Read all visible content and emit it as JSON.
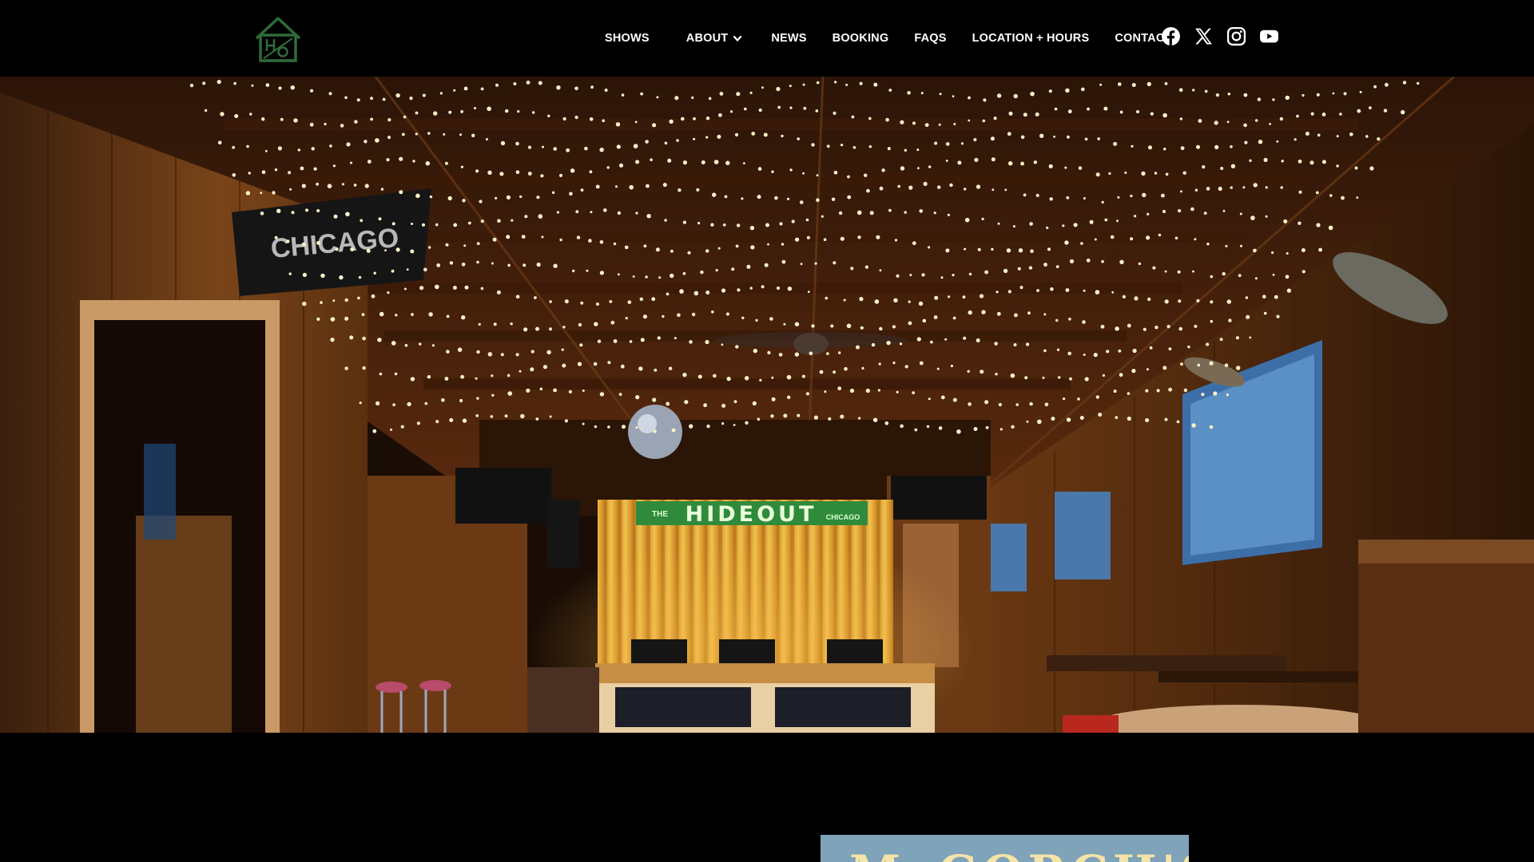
{
  "site": {
    "logo_icon": "hideout-house-logo-icon",
    "brand_color": "#2f6b3a"
  },
  "nav": {
    "items": [
      {
        "label": "SHOWS"
      },
      {
        "label": "ABOUT",
        "has_dropdown": true
      },
      {
        "label": "NEWS"
      },
      {
        "label": "BOOKING"
      },
      {
        "label": "FAQS"
      },
      {
        "label": "LOCATION + HOURS"
      },
      {
        "label": "CONTACT"
      }
    ]
  },
  "social": [
    {
      "icon": "facebook-icon"
    },
    {
      "icon": "x-twitter-icon"
    },
    {
      "icon": "instagram-icon"
    },
    {
      "icon": "youtube-icon"
    }
  ],
  "hero": {
    "wall_sign": "CHICAGO",
    "stage_banner_main": "HIDEOUT",
    "stage_banner_prefix": "THE",
    "stage_banner_suffix": "CHICAGO"
  },
  "poster": {
    "partial_title": "McGORCH'S",
    "background": "#7fa3b8"
  }
}
